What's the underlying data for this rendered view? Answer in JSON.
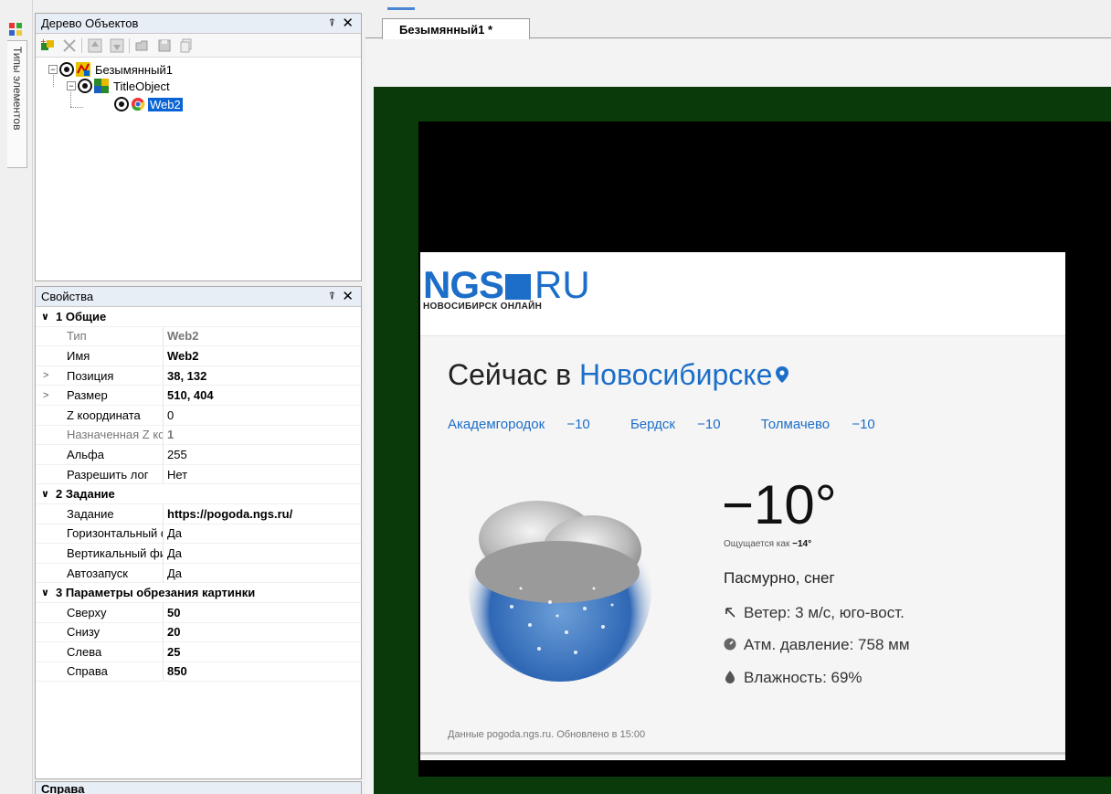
{
  "sidebar": {
    "vertical_tab": "Типы элементов"
  },
  "tree_panel": {
    "title": "Дерево Объектов",
    "pin": "⍒",
    "close": "✕",
    "nodes": [
      {
        "label": "Безымянный1"
      },
      {
        "label": "TitleObject"
      },
      {
        "label": "Web2"
      }
    ]
  },
  "props_panel": {
    "title": "Свойства",
    "pin": "⍒",
    "close": "✕",
    "groups": [
      {
        "label": "1 Общие"
      },
      {
        "label": "2 Задание"
      },
      {
        "label": "3 Параметры обрезания картинки"
      }
    ],
    "rows": [
      {
        "name": "Тип",
        "value": "Web2"
      },
      {
        "name": "Имя",
        "value": "Web2"
      },
      {
        "name": "Позиция",
        "value": "38, 132"
      },
      {
        "name": "Размер",
        "value": "510, 404"
      },
      {
        "name": "Z координата",
        "value": "0"
      },
      {
        "name": "Назначенная Z коо",
        "value": "1"
      },
      {
        "name": "Альфа",
        "value": "255"
      },
      {
        "name": "Разрешить лог",
        "value": "Нет"
      },
      {
        "name": "Задание",
        "value": "https://pogoda.ngs.ru/"
      },
      {
        "name": "Горизонтальный ф",
        "value": "Да"
      },
      {
        "name": "Вертикальный фил",
        "value": "Да"
      },
      {
        "name": "Автозапуск",
        "value": "Да"
      },
      {
        "name": "Сверху",
        "value": "50"
      },
      {
        "name": "Снизу",
        "value": "20"
      },
      {
        "name": "Слева",
        "value": "25"
      },
      {
        "name": "Справа",
        "value": "850"
      }
    ]
  },
  "help_panel": {
    "title": "Справа"
  },
  "document": {
    "tab_label": "Безымянный1 *"
  },
  "web": {
    "logo_left": "NGS",
    "logo_right": "RU",
    "logo_sub": "НОВОСИБИРСК ОНЛАЙН",
    "headline_prefix": "Сейчас в ",
    "headline_city": "Новосибирске",
    "nearby": [
      {
        "place": "Академгородок",
        "value": "−10"
      },
      {
        "place": "Бердск",
        "value": "−10"
      },
      {
        "place": "Толмачево",
        "value": "−10"
      }
    ],
    "temperature": "−10°",
    "feels_prefix": "Ощущается как ",
    "feels_value": "−14°",
    "condition": "Пасмурно, снег",
    "wind": "Ветер: 3 м/с, юго-вост.",
    "pressure": "Атм. давление: 758 мм",
    "humidity": "Влажность: 69%",
    "footer": "Данные pogoda.ngs.ru. Обновлено в 15:00"
  },
  "colors": {
    "accent": "#1c6ec8",
    "selection": "#0a64d6",
    "scene": "#0a3a0a"
  }
}
